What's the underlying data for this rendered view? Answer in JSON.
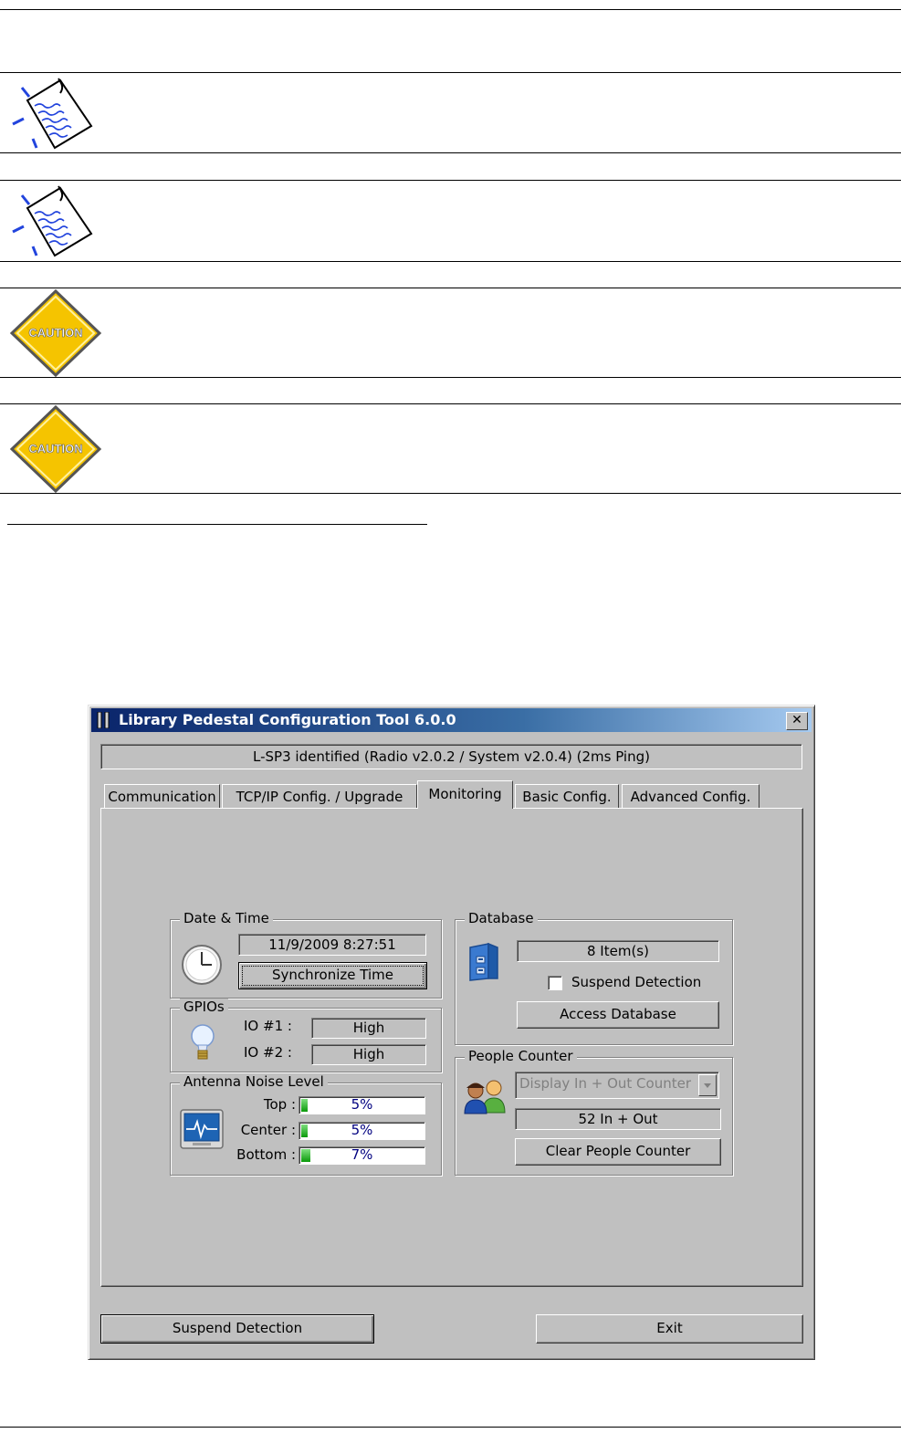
{
  "window": {
    "title": "Library Pedestal Configuration Tool 6.0.0",
    "close_label": "✕",
    "status": "L-SP3 identified (Radio v2.0.2 / System v2.0.4) (2ms Ping)"
  },
  "tabs": [
    {
      "label": "Communication"
    },
    {
      "label": "TCP/IP Config. / Upgrade"
    },
    {
      "label": "Monitoring",
      "active": true
    },
    {
      "label": "Basic Config."
    },
    {
      "label": "Advanced Config."
    }
  ],
  "date_time": {
    "title": "Date & Time",
    "value": "11/9/2009 8:27:51",
    "sync_button": "Synchronize Time"
  },
  "gpios": {
    "title": "GPIOs",
    "io1_label": "IO #1 :",
    "io1_value": "High",
    "io2_label": "IO #2 :",
    "io2_value": "High"
  },
  "antenna": {
    "title": "Antenna Noise Level",
    "rows": [
      {
        "label": "Top :",
        "text": "5%",
        "level": 5
      },
      {
        "label": "Center :",
        "text": "5%",
        "level": 5
      },
      {
        "label": "Bottom :",
        "text": "7%",
        "level": 7
      }
    ]
  },
  "database": {
    "title": "Database",
    "items": "8 Item(s)",
    "suspend_label": "Suspend Detection",
    "suspend_checked": false,
    "access_button": "Access Database"
  },
  "people_counter": {
    "title": "People Counter",
    "mode": "Display In + Out Counter",
    "count": "52 In + Out",
    "clear_button": "Clear People Counter"
  },
  "footer": {
    "suspend_button": "Suspend Detection",
    "exit_button": "Exit"
  },
  "colors": {
    "titlebar": "#0a246a",
    "face": "#c0c0c0",
    "progress_fill": "#0a9a0a",
    "progress_text": "#000080",
    "caution_yellow": "#f5c400"
  },
  "icons": [
    "note-icon",
    "caution-icon",
    "clock-icon",
    "lightbulb-icon",
    "monitor-icon",
    "database-icon",
    "people-icon"
  ]
}
